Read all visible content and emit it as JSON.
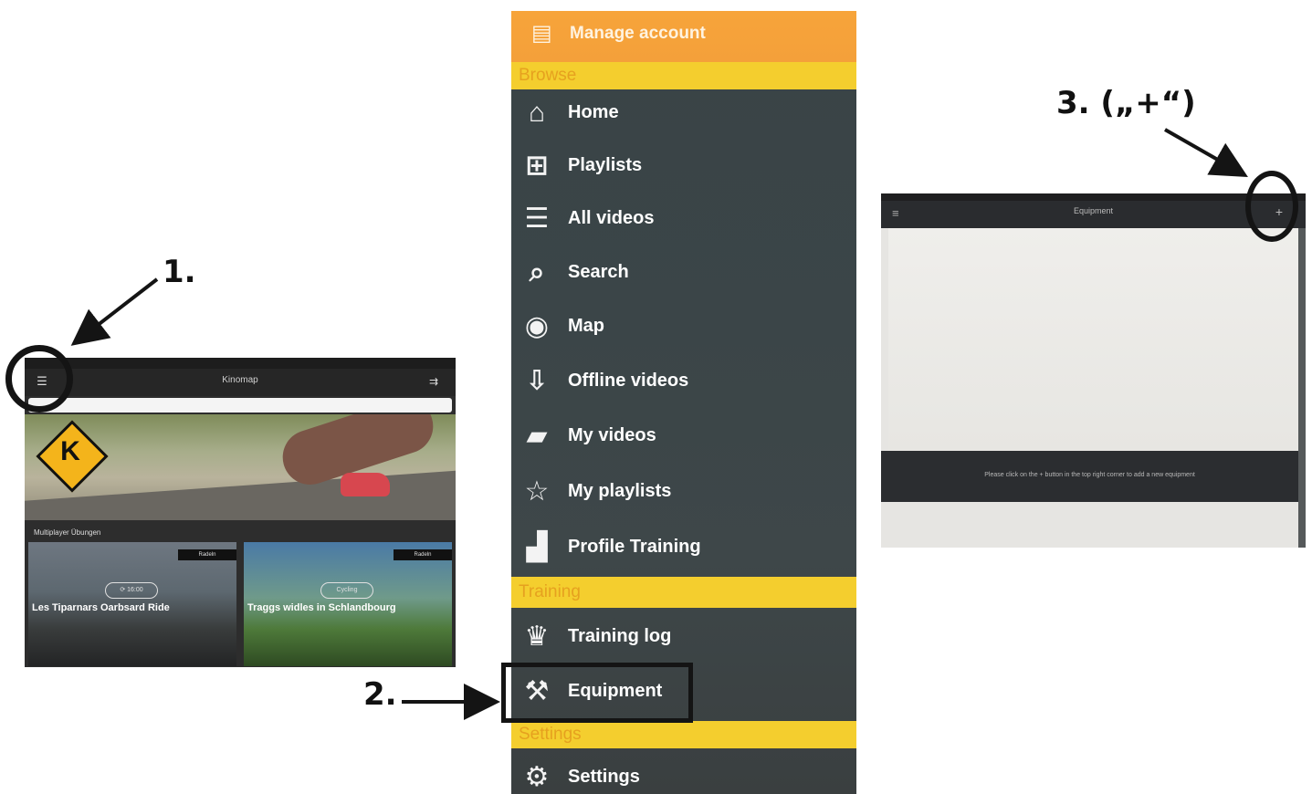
{
  "steps": {
    "step1": "1.",
    "step2": "2.",
    "step3": "3. („+“)"
  },
  "screen1": {
    "app_title": "Kinomap",
    "menu_icon": "hamburger-icon",
    "cast_icon": "cast-icon",
    "section_label": "Multiplayer Übungen",
    "cards": [
      {
        "title": "Les Tiparnars Oarbsard Ride",
        "pill": "⟳ 16:00",
        "badge": "Radeln"
      },
      {
        "title": "Traggs widles in Schlandbourg",
        "pill": "Cycling",
        "badge": "Radeln"
      }
    ],
    "logo_letter": "K"
  },
  "screen2": {
    "top_label": "Manage account",
    "sections": {
      "browse": "Browse",
      "training": "Training",
      "settings": "Settings"
    },
    "items": [
      {
        "label": "Home",
        "icon": "home-icon",
        "glyph": "⌂"
      },
      {
        "label": "Playlists",
        "icon": "grid-icon",
        "glyph": "⊞"
      },
      {
        "label": "All videos",
        "icon": "list-icon",
        "glyph": "☰"
      },
      {
        "label": "Search",
        "icon": "search-icon",
        "glyph": "⌕"
      },
      {
        "label": "Map",
        "icon": "globe-icon",
        "glyph": "◉"
      },
      {
        "label": "Offline videos",
        "icon": "download-box-icon",
        "glyph": "⇩"
      },
      {
        "label": "My videos",
        "icon": "video-camera-icon",
        "glyph": "▰"
      },
      {
        "label": "My playlists",
        "icon": "star-icon",
        "glyph": "☆"
      },
      {
        "label": "Profile Training",
        "icon": "bar-chart-icon",
        "glyph": "▟"
      },
      {
        "label": "Training log",
        "icon": "trophy-icon",
        "glyph": "♛"
      },
      {
        "label": "Equipment",
        "icon": "wrench-icon",
        "glyph": "⚒"
      },
      {
        "label": "Settings",
        "icon": "gears-icon",
        "glyph": "⚙"
      }
    ]
  },
  "screen3": {
    "title": "Equipment",
    "back_glyph": "≡",
    "plus_glyph": "+",
    "hint": "Please click on the + button in the top right corner to add a new equipment"
  }
}
